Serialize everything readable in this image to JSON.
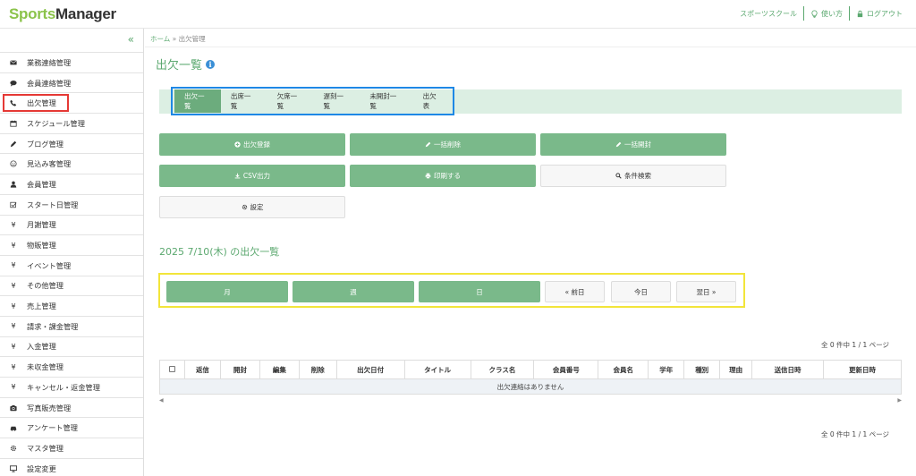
{
  "header": {
    "logo_sports": "Sports",
    "logo_manager": "Manager",
    "links": {
      "school": "スポーツスクール",
      "help": "使い方",
      "logout": "ログアウト"
    }
  },
  "sidebar": {
    "collapse": "«",
    "items": [
      {
        "label": "業務連絡管理",
        "icon": "envelope-icon"
      },
      {
        "label": "会員連絡管理",
        "icon": "comment-icon"
      },
      {
        "label": "出欠管理",
        "icon": "phone-icon",
        "highlighted": true
      },
      {
        "label": "スケジュール管理",
        "icon": "calendar-icon"
      },
      {
        "label": "ブログ管理",
        "icon": "pencil-icon"
      },
      {
        "label": "見込み客管理",
        "icon": "smile-icon"
      },
      {
        "label": "会員管理",
        "icon": "user-icon"
      },
      {
        "label": "スタート日管理",
        "icon": "checkbox-icon"
      },
      {
        "label": "月謝管理",
        "icon": "yen-icon"
      },
      {
        "label": "物販管理",
        "icon": "yen-icon"
      },
      {
        "label": "イベント管理",
        "icon": "yen-icon"
      },
      {
        "label": "その他管理",
        "icon": "yen-icon"
      },
      {
        "label": "売上管理",
        "icon": "yen-icon"
      },
      {
        "label": "請求・課金管理",
        "icon": "yen-icon"
      },
      {
        "label": "入金管理",
        "icon": "yen-icon"
      },
      {
        "label": "未収金管理",
        "icon": "yen-icon"
      },
      {
        "label": "キャンセル・返金管理",
        "icon": "yen-icon"
      },
      {
        "label": "写真販売管理",
        "icon": "camera-icon"
      },
      {
        "label": "アンケート管理",
        "icon": "car-icon"
      },
      {
        "label": "マスタ管理",
        "icon": "gear-icon"
      },
      {
        "label": "設定変更",
        "icon": "monitor-icon"
      }
    ]
  },
  "breadcrumb": {
    "home": "ホーム",
    "sep": "»",
    "current": "出欠管理"
  },
  "page_title": "出欠一覧",
  "tabs": [
    "出欠一覧",
    "出席一覧",
    "欠席一覧",
    "遅刻一覧",
    "未開封一覧",
    "出欠表"
  ],
  "actions": {
    "register": "出欠登録",
    "bulk_delete": "一括削除",
    "bulk_open": "一括開封",
    "csv": "CSV出力",
    "print": "印刷する",
    "search": "条件検索",
    "settings": "設定"
  },
  "date_heading": "2025 7/10(木) の出欠一覧",
  "date_nav": {
    "month": "月",
    "week": "週",
    "day": "日",
    "prev": "« 前日",
    "today": "今日",
    "next": "翌日 »"
  },
  "pagination_text": "全 0 件中 1 / 1 ページ",
  "table": {
    "columns": [
      "返信",
      "開封",
      "編集",
      "削除",
      "出欠日付",
      "タイトル",
      "クラス名",
      "会員番号",
      "会員名",
      "学年",
      "種別",
      "理由",
      "送信日時",
      "更新日時"
    ],
    "empty_message": "出欠連絡はありません"
  },
  "colors": {
    "accent": "#5ba86f",
    "button_green": "#7ab98a",
    "tab_band": "#dcefe3",
    "tab_highlight_border": "#1e88e5",
    "nav_highlight_border": "#f2e53a",
    "sidebar_highlight_border": "#e53935"
  }
}
